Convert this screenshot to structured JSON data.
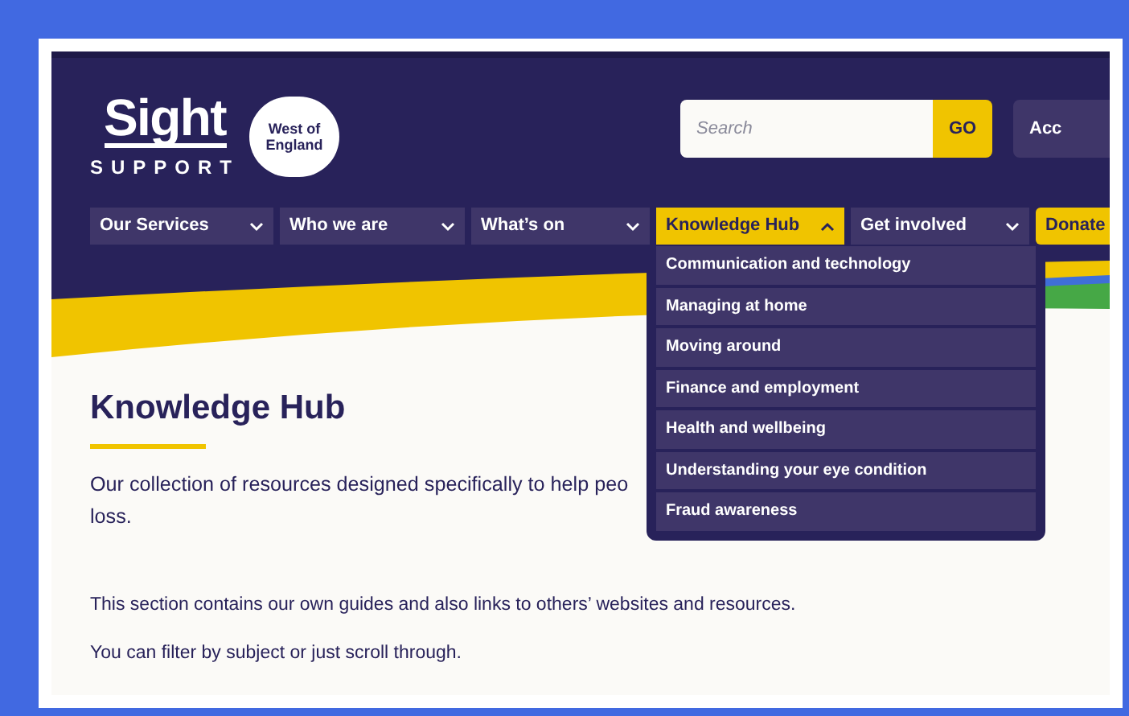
{
  "logo": {
    "name": "Sight",
    "subtitle": "SUPPORT",
    "badge": "West of England"
  },
  "search": {
    "placeholder": "Search",
    "button": "GO"
  },
  "account_button": "Acc",
  "nav": [
    {
      "label": "Our Services",
      "expanded": false,
      "kind": "menu"
    },
    {
      "label": "Who we are",
      "expanded": false,
      "kind": "menu"
    },
    {
      "label": "What’s on",
      "expanded": false,
      "kind": "menu"
    },
    {
      "label": "Knowledge Hub",
      "expanded": true,
      "kind": "menu"
    },
    {
      "label": "Get involved",
      "expanded": false,
      "kind": "menu"
    },
    {
      "label": "Donate",
      "kind": "donate"
    }
  ],
  "dropdown": [
    "Communication and technology",
    "Managing at home",
    "Moving around",
    "Finance and employment",
    "Health and wellbeing",
    "Understanding your eye condition",
    "Fraud awareness"
  ],
  "heading": "Knowledge Hub",
  "intro_lines": [
    "Our collection of resources designed specifically to help peo",
    "loss."
  ],
  "paragraphs": [
    "This section contains our own guides and also links to others’ websites and resources.",
    "You can filter by subject or just scroll through."
  ]
}
